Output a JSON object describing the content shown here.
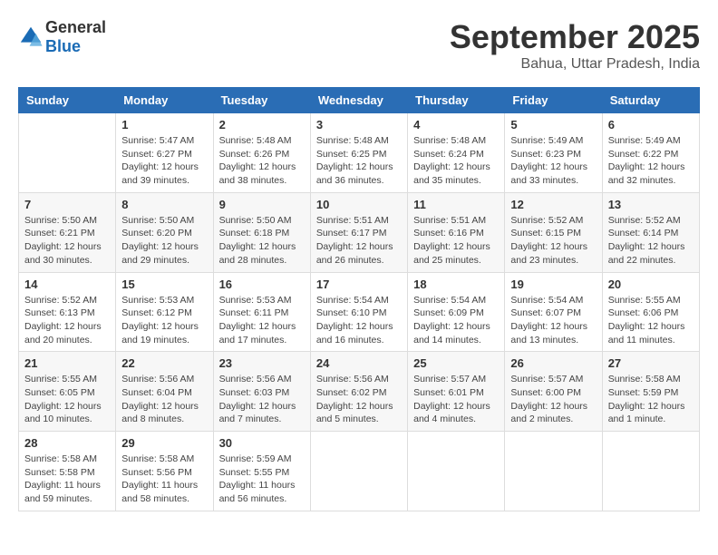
{
  "header": {
    "logo": {
      "general": "General",
      "blue": "Blue"
    },
    "title": "September 2025",
    "location": "Bahua, Uttar Pradesh, India"
  },
  "weekdays": [
    "Sunday",
    "Monday",
    "Tuesday",
    "Wednesday",
    "Thursday",
    "Friday",
    "Saturday"
  ],
  "weeks": [
    [
      {
        "day": "",
        "info": ""
      },
      {
        "day": "1",
        "info": "Sunrise: 5:47 AM\nSunset: 6:27 PM\nDaylight: 12 hours\nand 39 minutes."
      },
      {
        "day": "2",
        "info": "Sunrise: 5:48 AM\nSunset: 6:26 PM\nDaylight: 12 hours\nand 38 minutes."
      },
      {
        "day": "3",
        "info": "Sunrise: 5:48 AM\nSunset: 6:25 PM\nDaylight: 12 hours\nand 36 minutes."
      },
      {
        "day": "4",
        "info": "Sunrise: 5:48 AM\nSunset: 6:24 PM\nDaylight: 12 hours\nand 35 minutes."
      },
      {
        "day": "5",
        "info": "Sunrise: 5:49 AM\nSunset: 6:23 PM\nDaylight: 12 hours\nand 33 minutes."
      },
      {
        "day": "6",
        "info": "Sunrise: 5:49 AM\nSunset: 6:22 PM\nDaylight: 12 hours\nand 32 minutes."
      }
    ],
    [
      {
        "day": "7",
        "info": "Sunrise: 5:50 AM\nSunset: 6:21 PM\nDaylight: 12 hours\nand 30 minutes."
      },
      {
        "day": "8",
        "info": "Sunrise: 5:50 AM\nSunset: 6:20 PM\nDaylight: 12 hours\nand 29 minutes."
      },
      {
        "day": "9",
        "info": "Sunrise: 5:50 AM\nSunset: 6:18 PM\nDaylight: 12 hours\nand 28 minutes."
      },
      {
        "day": "10",
        "info": "Sunrise: 5:51 AM\nSunset: 6:17 PM\nDaylight: 12 hours\nand 26 minutes."
      },
      {
        "day": "11",
        "info": "Sunrise: 5:51 AM\nSunset: 6:16 PM\nDaylight: 12 hours\nand 25 minutes."
      },
      {
        "day": "12",
        "info": "Sunrise: 5:52 AM\nSunset: 6:15 PM\nDaylight: 12 hours\nand 23 minutes."
      },
      {
        "day": "13",
        "info": "Sunrise: 5:52 AM\nSunset: 6:14 PM\nDaylight: 12 hours\nand 22 minutes."
      }
    ],
    [
      {
        "day": "14",
        "info": "Sunrise: 5:52 AM\nSunset: 6:13 PM\nDaylight: 12 hours\nand 20 minutes."
      },
      {
        "day": "15",
        "info": "Sunrise: 5:53 AM\nSunset: 6:12 PM\nDaylight: 12 hours\nand 19 minutes."
      },
      {
        "day": "16",
        "info": "Sunrise: 5:53 AM\nSunset: 6:11 PM\nDaylight: 12 hours\nand 17 minutes."
      },
      {
        "day": "17",
        "info": "Sunrise: 5:54 AM\nSunset: 6:10 PM\nDaylight: 12 hours\nand 16 minutes."
      },
      {
        "day": "18",
        "info": "Sunrise: 5:54 AM\nSunset: 6:09 PM\nDaylight: 12 hours\nand 14 minutes."
      },
      {
        "day": "19",
        "info": "Sunrise: 5:54 AM\nSunset: 6:07 PM\nDaylight: 12 hours\nand 13 minutes."
      },
      {
        "day": "20",
        "info": "Sunrise: 5:55 AM\nSunset: 6:06 PM\nDaylight: 12 hours\nand 11 minutes."
      }
    ],
    [
      {
        "day": "21",
        "info": "Sunrise: 5:55 AM\nSunset: 6:05 PM\nDaylight: 12 hours\nand 10 minutes."
      },
      {
        "day": "22",
        "info": "Sunrise: 5:56 AM\nSunset: 6:04 PM\nDaylight: 12 hours\nand 8 minutes."
      },
      {
        "day": "23",
        "info": "Sunrise: 5:56 AM\nSunset: 6:03 PM\nDaylight: 12 hours\nand 7 minutes."
      },
      {
        "day": "24",
        "info": "Sunrise: 5:56 AM\nSunset: 6:02 PM\nDaylight: 12 hours\nand 5 minutes."
      },
      {
        "day": "25",
        "info": "Sunrise: 5:57 AM\nSunset: 6:01 PM\nDaylight: 12 hours\nand 4 minutes."
      },
      {
        "day": "26",
        "info": "Sunrise: 5:57 AM\nSunset: 6:00 PM\nDaylight: 12 hours\nand 2 minutes."
      },
      {
        "day": "27",
        "info": "Sunrise: 5:58 AM\nSunset: 5:59 PM\nDaylight: 12 hours\nand 1 minute."
      }
    ],
    [
      {
        "day": "28",
        "info": "Sunrise: 5:58 AM\nSunset: 5:58 PM\nDaylight: 11 hours\nand 59 minutes."
      },
      {
        "day": "29",
        "info": "Sunrise: 5:58 AM\nSunset: 5:56 PM\nDaylight: 11 hours\nand 58 minutes."
      },
      {
        "day": "30",
        "info": "Sunrise: 5:59 AM\nSunset: 5:55 PM\nDaylight: 11 hours\nand 56 minutes."
      },
      {
        "day": "",
        "info": ""
      },
      {
        "day": "",
        "info": ""
      },
      {
        "day": "",
        "info": ""
      },
      {
        "day": "",
        "info": ""
      }
    ]
  ]
}
